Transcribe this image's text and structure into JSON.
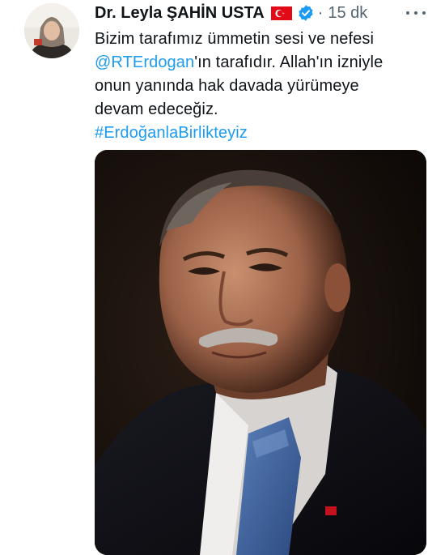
{
  "tweet": {
    "author_name": "Dr. Leyla ŞAHİN USTA",
    "dot": "·",
    "time": "15 dk",
    "lines": [
      "Bizim tarafımız ümmetin sesi ve nefesi",
      "'ın tarafıdır. Allah'ın izniyle",
      "onun yanında hak davada yürümeye",
      "devam edeceğiz."
    ],
    "mention": "@RTErdogan",
    "hashtag": "#ErdoğanlaBirlikteyiz"
  },
  "colors": {
    "link": "#1d9bf0",
    "text": "#0f1419",
    "muted": "#536471",
    "flag_red": "#e30a17"
  },
  "icons": {
    "flag": "turkey-flag-icon",
    "verified": "verified-badge-icon",
    "more": "more-icon"
  }
}
